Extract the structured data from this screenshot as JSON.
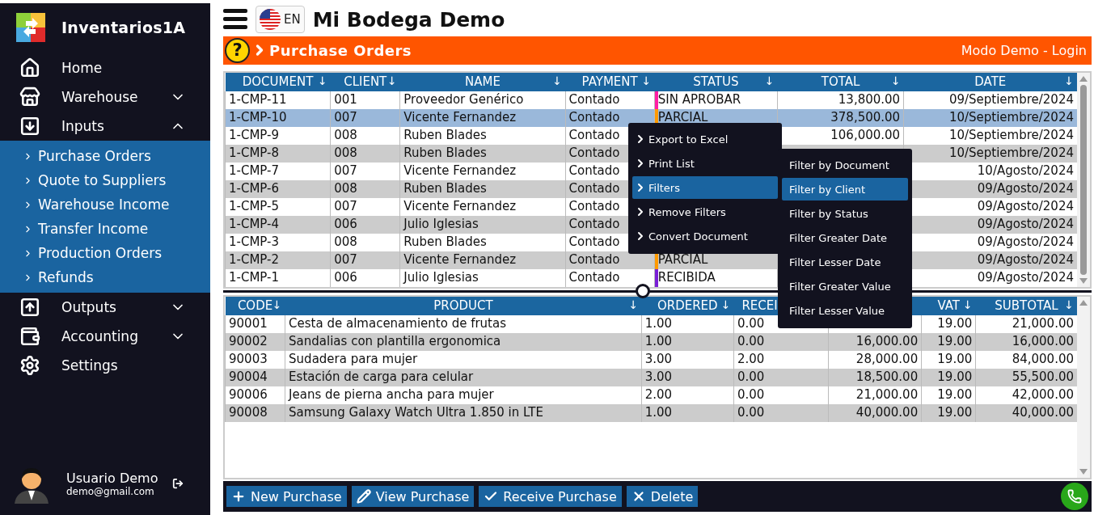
{
  "app": {
    "name": "Inventarios1A"
  },
  "sidebar": {
    "items": [
      {
        "label": "Home"
      },
      {
        "label": "Warehouse",
        "expanded": false
      },
      {
        "label": "Inputs",
        "expanded": true,
        "children": [
          {
            "label": "Purchase Orders"
          },
          {
            "label": "Quote to Suppliers"
          },
          {
            "label": "Warehouse Income"
          },
          {
            "label": "Transfer Income"
          },
          {
            "label": "Production Orders"
          },
          {
            "label": "Refunds"
          }
        ]
      },
      {
        "label": "Outputs",
        "expanded": false
      },
      {
        "label": "Accounting",
        "expanded": false
      },
      {
        "label": "Settings"
      }
    ]
  },
  "user": {
    "name": "Usuario Demo",
    "email": "demo@gmail.com"
  },
  "topbar": {
    "language": "EN",
    "title": "Mi Bodega Demo"
  },
  "page_bar": {
    "help": "?",
    "title": "Purchase Orders",
    "login": "Modo Demo - Login"
  },
  "orders": {
    "columns": [
      {
        "label": "DOCUMENT",
        "sort": "↓",
        "kind": "text"
      },
      {
        "label": "CLIENT",
        "sort": "↓",
        "kind": "text"
      },
      {
        "label": "NAME",
        "sort": "↓",
        "kind": "text"
      },
      {
        "label": "PAYMENT",
        "sort": "↓",
        "kind": "text"
      },
      {
        "label": "STATUS",
        "sort": "↓",
        "kind": "text"
      },
      {
        "label": "TOTAL",
        "sort": "↓",
        "kind": "number"
      },
      {
        "label": "DATE",
        "sort": "↓",
        "kind": "number"
      }
    ],
    "rows": [
      {
        "selected": false,
        "color": "#ff1fa5",
        "cells": [
          "1-CMP-11",
          "001",
          "Proveedor Genérico",
          "Contado",
          "SIN APROBAR",
          "13,800.00",
          "09/Septiembre/2024"
        ]
      },
      {
        "selected": true,
        "color": "#ff9a00",
        "cells": [
          "1-CMP-10",
          "007",
          "Vicente Fernandez",
          "Contado",
          "PARCIAL",
          "378,500.00",
          "10/Septiembre/2024"
        ]
      },
      {
        "selected": false,
        "cells": [
          "1-CMP-9",
          "008",
          "Ruben Blades",
          "Contado",
          null,
          "106,000.00",
          "10/Septiembre/2024"
        ]
      },
      {
        "selected": false,
        "cells": [
          "1-CMP-8",
          "008",
          "Ruben Blades",
          "Contado",
          null,
          null,
          "10/Septiembre/2024"
        ]
      },
      {
        "selected": false,
        "cells": [
          "1-CMP-7",
          "007",
          "Vicente Fernandez",
          "Contado",
          null,
          null,
          "10/Agosto/2024"
        ]
      },
      {
        "selected": false,
        "cells": [
          "1-CMP-6",
          "008",
          "Ruben Blades",
          "Contado",
          null,
          null,
          "09/Agosto/2024"
        ]
      },
      {
        "selected": false,
        "cells": [
          "1-CMP-5",
          "007",
          "Vicente Fernandez",
          "Contado",
          null,
          null,
          "09/Agosto/2024"
        ]
      },
      {
        "selected": false,
        "cells": [
          "1-CMP-4",
          "006",
          "Julio Iglesias",
          "Contado",
          null,
          null,
          "09/Agosto/2024"
        ]
      },
      {
        "selected": false,
        "cells": [
          "1-CMP-3",
          "008",
          "Ruben Blades",
          "Contado",
          null,
          null,
          "09/Agosto/2024"
        ]
      },
      {
        "selected": false,
        "color": "#ff9a00",
        "cells": [
          "1-CMP-2",
          "007",
          "Vicente Fernandez",
          "Contado",
          "PARCIAL",
          null,
          "09/Agosto/2024"
        ]
      },
      {
        "selected": false,
        "color": "#7a1fd6",
        "cells": [
          "1-CMP-1",
          "006",
          "Julio Iglesias",
          "Contado",
          "RECIBIDA",
          null,
          "09/Agosto/2024"
        ]
      }
    ]
  },
  "items": {
    "columns": [
      {
        "label": "CODE",
        "sort": "↓",
        "kind": "text"
      },
      {
        "label": "PRODUCT",
        "sort": "↓",
        "kind": "text"
      },
      {
        "label": "ORDERED",
        "sort": "↓",
        "kind": "text"
      },
      {
        "label": "RECEI",
        "kind": "text"
      },
      {
        "kind": "number"
      },
      {
        "label": "VAT",
        "sort": "↓",
        "kind": "number"
      },
      {
        "label": "SUBTOTAL",
        "sort": "↓",
        "kind": "number"
      }
    ],
    "rows": [
      {
        "cells": [
          "90001",
          "Cesta de almacenamiento de frutas",
          "1.00",
          "0.00",
          null,
          "19.00",
          "21,000.00"
        ]
      },
      {
        "cells": [
          "90002",
          "Sandalias con plantilla ergonomica",
          "1.00",
          "0.00",
          "16,000.00",
          "19.00",
          "16,000.00"
        ]
      },
      {
        "cells": [
          "90003",
          "Sudadera para mujer",
          "3.00",
          "2.00",
          "28,000.00",
          "19.00",
          "84,000.00"
        ]
      },
      {
        "cells": [
          "90004",
          "Estación de carga para celular",
          "3.00",
          "0.00",
          "18,500.00",
          "19.00",
          "55,500.00"
        ]
      },
      {
        "cells": [
          "90006",
          "Jeans de pierna ancha para mujer",
          "2.00",
          "0.00",
          "21,000.00",
          "19.00",
          "42,000.00"
        ]
      },
      {
        "cells": [
          "90008",
          "Samsung Galaxy Watch Ultra 1.850 in LTE",
          "1.00",
          "0.00",
          "40,000.00",
          "19.00",
          "40,000.00"
        ]
      }
    ]
  },
  "context_menu": {
    "items": [
      {
        "label": "Export to Excel",
        "selected": false
      },
      {
        "label": "Print List",
        "selected": false
      },
      {
        "label": "Filters",
        "selected": true
      },
      {
        "label": "Remove Filters",
        "selected": false
      },
      {
        "label": "Convert Document",
        "selected": false
      }
    ],
    "submenu": [
      {
        "label": "Filter by Document",
        "selected": false
      },
      {
        "label": "Filter by Client",
        "selected": true
      },
      {
        "label": "Filter by Status",
        "selected": false
      },
      {
        "label": "Filter Greater Date",
        "selected": false
      },
      {
        "label": "Filter Lesser Date",
        "selected": false
      },
      {
        "label": "Filter Greater Value",
        "selected": false
      },
      {
        "label": "Filter Lesser Value",
        "selected": false
      }
    ]
  },
  "toolbar": {
    "buttons": [
      {
        "label": "New Purchase"
      },
      {
        "label": "View Purchase"
      },
      {
        "label": "Receive Purchase"
      },
      {
        "label": "Delete"
      }
    ]
  }
}
